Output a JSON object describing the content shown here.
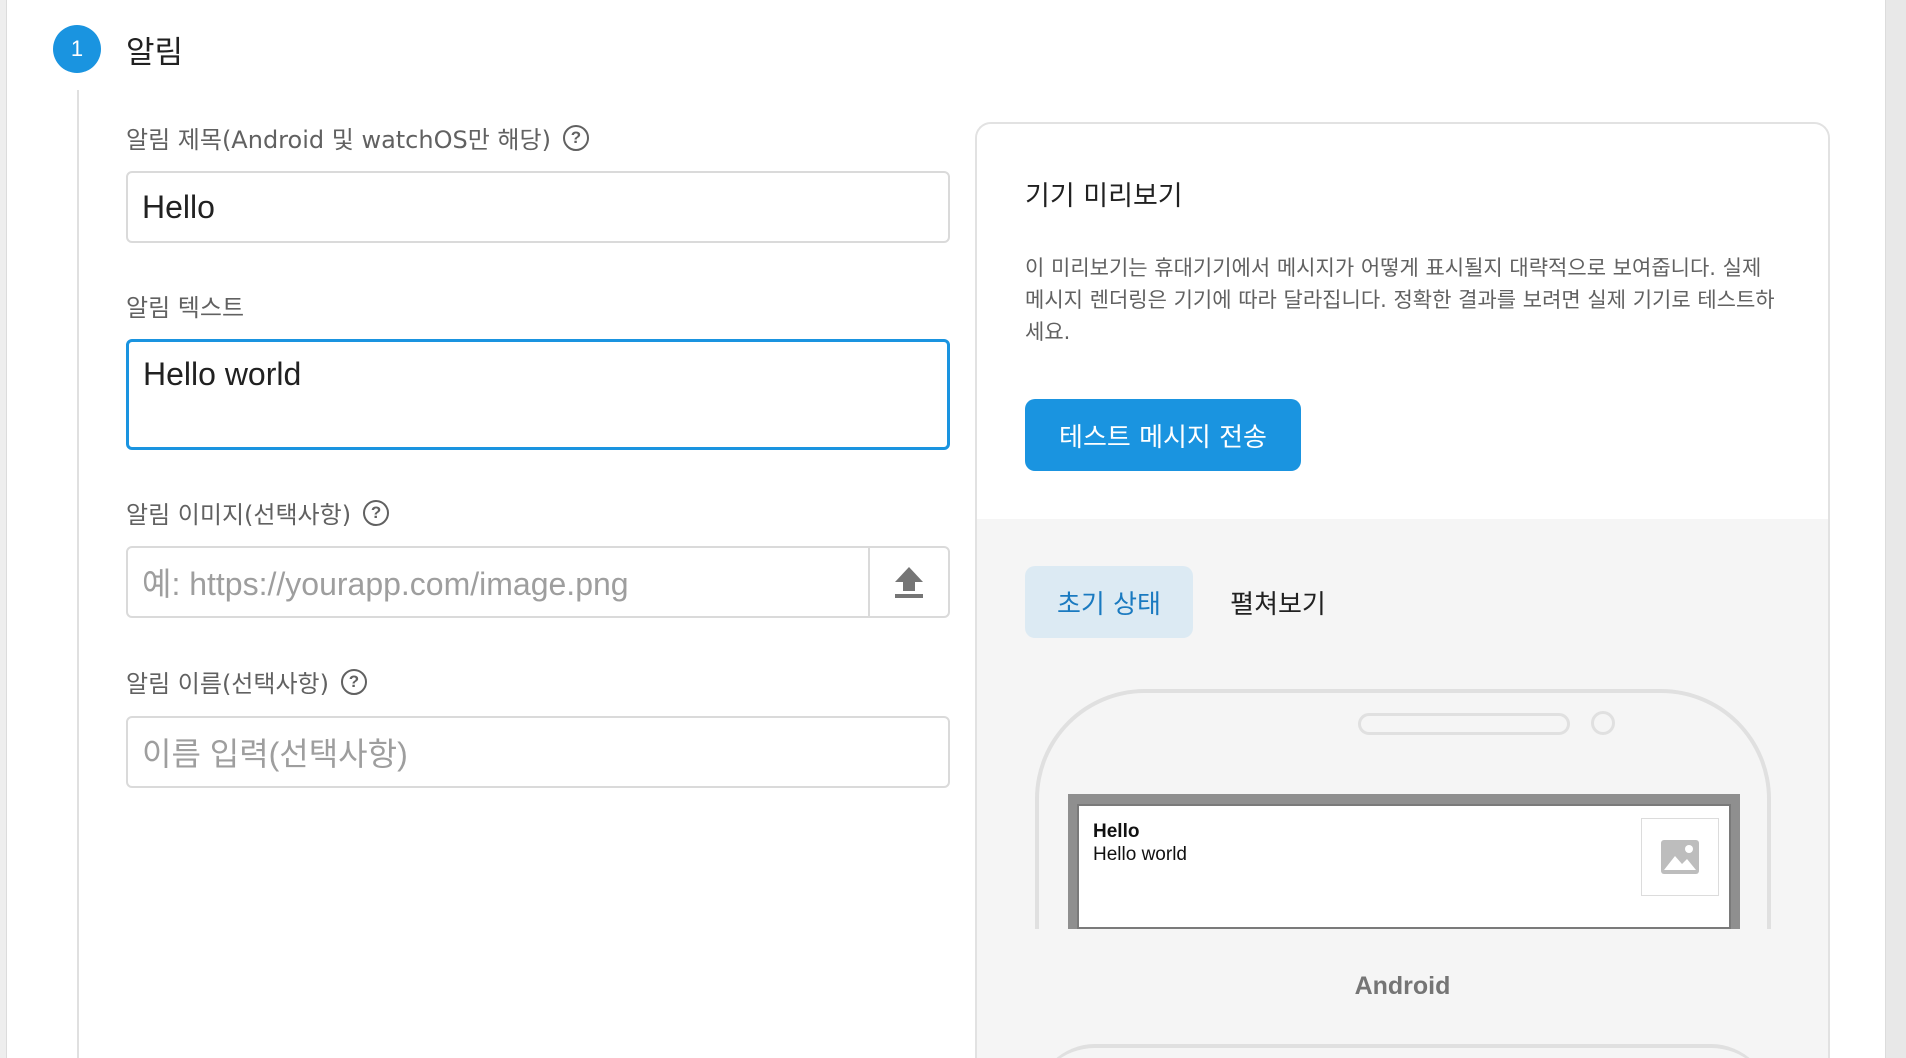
{
  "step": {
    "number": "1",
    "title": "알림"
  },
  "form": {
    "title_label": "알림 제목(Android 및 watchOS만 해당)",
    "title_value": "Hello",
    "text_label": "알림 텍스트",
    "text_value": "Hello world",
    "image_label": "알림 이미지(선택사항)",
    "image_placeholder": "예: https://yourapp.com/image.png",
    "name_label": "알림 이름(선택사항)",
    "name_placeholder": "이름 입력(선택사항)",
    "help_glyph": "?"
  },
  "preview": {
    "title": "기기 미리보기",
    "description": "이 미리보기는 휴대기기에서 메시지가 어떻게 표시될지 대략적으로 보여줍니다. 실제 메시지 렌더링은 기기에 따라 달라집니다. 정확한 결과를 보려면 실제 기기로 테스트하세요.",
    "send_button": "테스트 메시지 전송",
    "tabs": [
      "초기 상태",
      "펼쳐보기"
    ],
    "active_tab": "초기 상태",
    "notification": {
      "title": "Hello",
      "body": "Hello world"
    },
    "platform": "Android"
  },
  "colors": {
    "accent": "#1a94e0",
    "active_tab_bg": "#dceaf3"
  },
  "icons": {
    "help": "help-circle-icon",
    "upload": "upload-icon",
    "image": "image-placeholder-icon"
  }
}
